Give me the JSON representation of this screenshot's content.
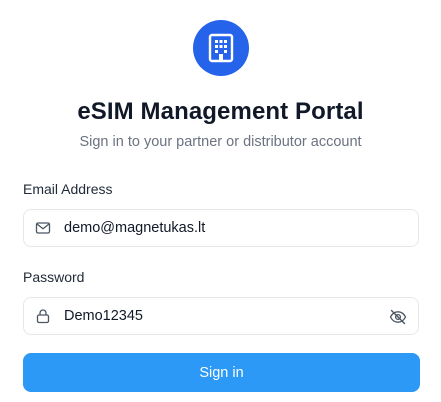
{
  "app": {
    "logo_icon": "building-icon",
    "accent_color": "#2563eb"
  },
  "header": {
    "title": "eSIM Management Portal",
    "subtitle": "Sign in to your partner or distributor account"
  },
  "form": {
    "email": {
      "label": "Email Address",
      "value": "demo@magnetukas.lt",
      "icon": "mail-icon"
    },
    "password": {
      "label": "Password",
      "value": "Demo12345",
      "icon": "lock-icon",
      "toggle_icon": "eye-off-icon"
    },
    "submit": {
      "label": "Sign in",
      "color": "#2b99f5"
    }
  }
}
